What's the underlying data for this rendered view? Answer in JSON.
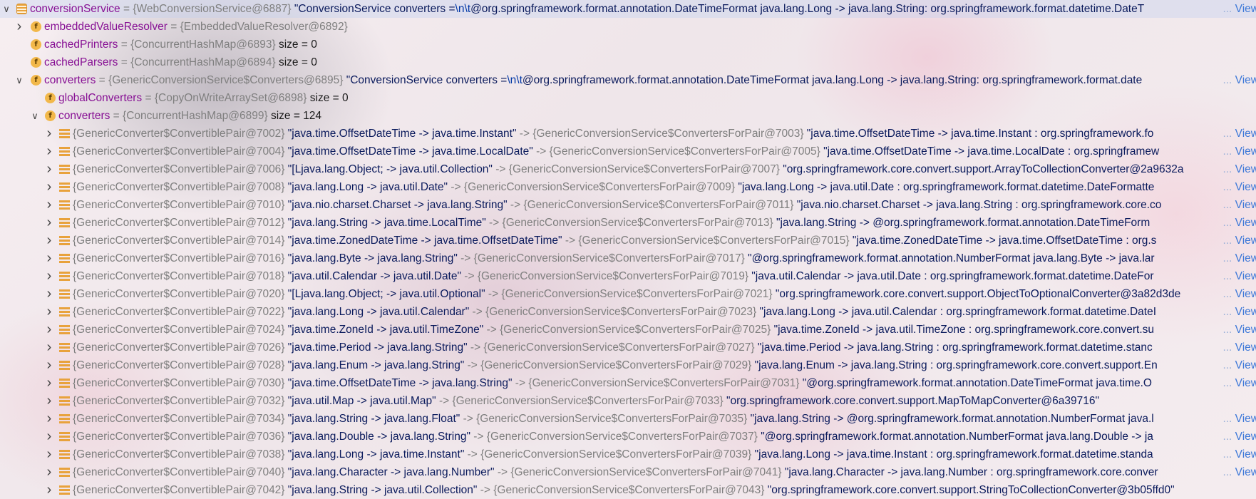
{
  "view_label": "View",
  "ellipsis": "...",
  "rows": [
    {
      "indent": 1,
      "chev": "down",
      "icon": "field-list",
      "selected": true,
      "name": "conversionService",
      "ref": "{WebConversionService@6887}",
      "value_parts": [
        {
          "t": "\"ConversionService converters =",
          "c": "str"
        },
        {
          "t": "\\n\\t",
          "c": "esc"
        },
        {
          "t": "@org.springframework.format.annotation.DateTimeFormat java.lang.Long -> java.lang.String: org.springframework.format.datetime.DateT",
          "c": "str"
        }
      ],
      "view": true
    },
    {
      "indent": 2,
      "chev": "right",
      "icon": "field",
      "name": "embeddedValueResolver",
      "ref": "{EmbeddedValueResolver@6892}",
      "value_parts": []
    },
    {
      "indent": 2,
      "chev": "",
      "icon": "field",
      "name": "cachedPrinters",
      "ref": "{ConcurrentHashMap@6893}",
      "value_parts": [
        {
          "t": " size = 0",
          "c": "sz"
        }
      ]
    },
    {
      "indent": 2,
      "chev": "",
      "icon": "field",
      "name": "cachedParsers",
      "ref": "{ConcurrentHashMap@6894}",
      "value_parts": [
        {
          "t": " size = 0",
          "c": "sz"
        }
      ]
    },
    {
      "indent": 2,
      "chev": "down",
      "icon": "field",
      "name": "converters",
      "ref": "{GenericConversionService$Converters@6895}",
      "value_parts": [
        {
          "t": "\"ConversionService converters =",
          "c": "str"
        },
        {
          "t": "\\n\\t",
          "c": "esc"
        },
        {
          "t": "@org.springframework.format.annotation.DateTimeFormat java.lang.Long -> java.lang.String: org.springframework.format.date",
          "c": "str"
        }
      ],
      "view": true
    },
    {
      "indent": 3,
      "chev": "",
      "icon": "field",
      "name": "globalConverters",
      "ref": "{CopyOnWriteArraySet@6898}",
      "value_parts": [
        {
          "t": " size = 0",
          "c": "sz"
        }
      ]
    },
    {
      "indent": 3,
      "chev": "down",
      "icon": "field",
      "name": "converters",
      "ref": "{ConcurrentHashMap@6899}",
      "value_parts": [
        {
          "t": " size = 124",
          "c": "sz"
        }
      ]
    },
    {
      "indent": 4,
      "chev": "right",
      "icon": "list",
      "name": "",
      "ref": "{GenericConverter$ConvertiblePair@7002}",
      "value_parts": [
        {
          "t": "\"java.time.OffsetDateTime -> java.time.Instant\"",
          "c": "str"
        },
        {
          "t": " -> {GenericConversionService$ConvertersForPair@7003}",
          "c": "ref"
        },
        {
          "t": " \"java.time.OffsetDateTime -> java.time.Instant : org.springframework.fo",
          "c": "str"
        }
      ],
      "view": true
    },
    {
      "indent": 4,
      "chev": "right",
      "icon": "list",
      "name": "",
      "ref": "{GenericConverter$ConvertiblePair@7004}",
      "value_parts": [
        {
          "t": "\"java.time.OffsetDateTime -> java.time.LocalDate\"",
          "c": "str"
        },
        {
          "t": " -> {GenericConversionService$ConvertersForPair@7005}",
          "c": "ref"
        },
        {
          "t": " \"java.time.OffsetDateTime -> java.time.LocalDate : org.springframew",
          "c": "str"
        }
      ],
      "view": true
    },
    {
      "indent": 4,
      "chev": "right",
      "icon": "list",
      "name": "",
      "ref": "{GenericConverter$ConvertiblePair@7006}",
      "value_parts": [
        {
          "t": "\"[Ljava.lang.Object; -> java.util.Collection\"",
          "c": "str"
        },
        {
          "t": " -> {GenericConversionService$ConvertersForPair@7007}",
          "c": "ref"
        },
        {
          "t": " \"org.springframework.core.convert.support.ArrayToCollectionConverter@2a9632a",
          "c": "str"
        }
      ],
      "view": true
    },
    {
      "indent": 4,
      "chev": "right",
      "icon": "list",
      "name": "",
      "ref": "{GenericConverter$ConvertiblePair@7008}",
      "value_parts": [
        {
          "t": "\"java.lang.Long -> java.util.Date\"",
          "c": "str"
        },
        {
          "t": " -> {GenericConversionService$ConvertersForPair@7009}",
          "c": "ref"
        },
        {
          "t": " \"java.lang.Long -> java.util.Date : org.springframework.format.datetime.DateFormatte",
          "c": "str"
        }
      ],
      "view": true
    },
    {
      "indent": 4,
      "chev": "right",
      "icon": "list",
      "name": "",
      "ref": "{GenericConverter$ConvertiblePair@7010}",
      "value_parts": [
        {
          "t": "\"java.nio.charset.Charset -> java.lang.String\"",
          "c": "str"
        },
        {
          "t": " -> {GenericConversionService$ConvertersForPair@7011}",
          "c": "ref"
        },
        {
          "t": " \"java.nio.charset.Charset -> java.lang.String : org.springframework.core.co",
          "c": "str"
        }
      ],
      "view": true
    },
    {
      "indent": 4,
      "chev": "right",
      "icon": "list",
      "name": "",
      "ref": "{GenericConverter$ConvertiblePair@7012}",
      "value_parts": [
        {
          "t": "\"java.lang.String -> java.time.LocalTime\"",
          "c": "str"
        },
        {
          "t": " -> {GenericConversionService$ConvertersForPair@7013}",
          "c": "ref"
        },
        {
          "t": " \"java.lang.String -> @org.springframework.format.annotation.DateTimeForm",
          "c": "str"
        }
      ],
      "view": true
    },
    {
      "indent": 4,
      "chev": "right",
      "icon": "list",
      "name": "",
      "ref": "{GenericConverter$ConvertiblePair@7014}",
      "value_parts": [
        {
          "t": "\"java.time.ZonedDateTime -> java.time.OffsetDateTime\"",
          "c": "str"
        },
        {
          "t": " -> {GenericConversionService$ConvertersForPair@7015}",
          "c": "ref"
        },
        {
          "t": " \"java.time.ZonedDateTime -> java.time.OffsetDateTime : org.s",
          "c": "str"
        }
      ],
      "view": true
    },
    {
      "indent": 4,
      "chev": "right",
      "icon": "list",
      "name": "",
      "ref": "{GenericConverter$ConvertiblePair@7016}",
      "value_parts": [
        {
          "t": "\"java.lang.Byte -> java.lang.String\"",
          "c": "str"
        },
        {
          "t": " -> {GenericConversionService$ConvertersForPair@7017}",
          "c": "ref"
        },
        {
          "t": " \"@org.springframework.format.annotation.NumberFormat java.lang.Byte -> java.lar",
          "c": "str"
        }
      ],
      "view": true
    },
    {
      "indent": 4,
      "chev": "right",
      "icon": "list",
      "name": "",
      "ref": "{GenericConverter$ConvertiblePair@7018}",
      "value_parts": [
        {
          "t": "\"java.util.Calendar -> java.util.Date\"",
          "c": "str"
        },
        {
          "t": " -> {GenericConversionService$ConvertersForPair@7019}",
          "c": "ref"
        },
        {
          "t": " \"java.util.Calendar -> java.util.Date : org.springframework.format.datetime.DateFor",
          "c": "str"
        }
      ],
      "view": true
    },
    {
      "indent": 4,
      "chev": "right",
      "icon": "list",
      "name": "",
      "ref": "{GenericConverter$ConvertiblePair@7020}",
      "value_parts": [
        {
          "t": "\"[Ljava.lang.Object; -> java.util.Optional\"",
          "c": "str"
        },
        {
          "t": " -> {GenericConversionService$ConvertersForPair@7021}",
          "c": "ref"
        },
        {
          "t": " \"org.springframework.core.convert.support.ObjectToOptionalConverter@3a82d3de",
          "c": "str"
        }
      ],
      "view": true
    },
    {
      "indent": 4,
      "chev": "right",
      "icon": "list",
      "name": "",
      "ref": "{GenericConverter$ConvertiblePair@7022}",
      "value_parts": [
        {
          "t": "\"java.lang.Long -> java.util.Calendar\"",
          "c": "str"
        },
        {
          "t": " -> {GenericConversionService$ConvertersForPair@7023}",
          "c": "ref"
        },
        {
          "t": " \"java.lang.Long -> java.util.Calendar : org.springframework.format.datetime.DateI",
          "c": "str"
        }
      ],
      "view": true
    },
    {
      "indent": 4,
      "chev": "right",
      "icon": "list",
      "name": "",
      "ref": "{GenericConverter$ConvertiblePair@7024}",
      "value_parts": [
        {
          "t": "\"java.time.ZoneId -> java.util.TimeZone\"",
          "c": "str"
        },
        {
          "t": " -> {GenericConversionService$ConvertersForPair@7025}",
          "c": "ref"
        },
        {
          "t": " \"java.time.ZoneId -> java.util.TimeZone : org.springframework.core.convert.su",
          "c": "str"
        }
      ],
      "view": true
    },
    {
      "indent": 4,
      "chev": "right",
      "icon": "list",
      "name": "",
      "ref": "{GenericConverter$ConvertiblePair@7026}",
      "value_parts": [
        {
          "t": "\"java.time.Period -> java.lang.String\"",
          "c": "str"
        },
        {
          "t": " -> {GenericConversionService$ConvertersForPair@7027}",
          "c": "ref"
        },
        {
          "t": " \"java.time.Period -> java.lang.String : org.springframework.format.datetime.stanc",
          "c": "str"
        }
      ],
      "view": true
    },
    {
      "indent": 4,
      "chev": "right",
      "icon": "list",
      "name": "",
      "ref": "{GenericConverter$ConvertiblePair@7028}",
      "value_parts": [
        {
          "t": "\"java.lang.Enum -> java.lang.String\"",
          "c": "str"
        },
        {
          "t": " -> {GenericConversionService$ConvertersForPair@7029}",
          "c": "ref"
        },
        {
          "t": " \"java.lang.Enum -> java.lang.String : org.springframework.core.convert.support.En",
          "c": "str"
        }
      ],
      "view": true
    },
    {
      "indent": 4,
      "chev": "right",
      "icon": "list",
      "name": "",
      "ref": "{GenericConverter$ConvertiblePair@7030}",
      "value_parts": [
        {
          "t": "\"java.time.OffsetDateTime -> java.lang.String\"",
          "c": "str"
        },
        {
          "t": " -> {GenericConversionService$ConvertersForPair@7031}",
          "c": "ref"
        },
        {
          "t": " \"@org.springframework.format.annotation.DateTimeFormat java.time.O",
          "c": "str"
        }
      ],
      "view": true
    },
    {
      "indent": 4,
      "chev": "right",
      "icon": "list",
      "name": "",
      "ref": "{GenericConverter$ConvertiblePair@7032}",
      "value_parts": [
        {
          "t": "\"java.util.Map -> java.util.Map\"",
          "c": "str"
        },
        {
          "t": " -> {GenericConversionService$ConvertersForPair@7033}",
          "c": "ref"
        },
        {
          "t": " \"org.springframework.core.convert.support.MapToMapConverter@6a39716\"",
          "c": "str"
        }
      ],
      "view": false
    },
    {
      "indent": 4,
      "chev": "right",
      "icon": "list",
      "name": "",
      "ref": "{GenericConverter$ConvertiblePair@7034}",
      "value_parts": [
        {
          "t": "\"java.lang.String -> java.lang.Float\"",
          "c": "str"
        },
        {
          "t": " -> {GenericConversionService$ConvertersForPair@7035}",
          "c": "ref"
        },
        {
          "t": " \"java.lang.String -> @org.springframework.format.annotation.NumberFormat java.l",
          "c": "str"
        }
      ],
      "view": true
    },
    {
      "indent": 4,
      "chev": "right",
      "icon": "list",
      "name": "",
      "ref": "{GenericConverter$ConvertiblePair@7036}",
      "value_parts": [
        {
          "t": "\"java.lang.Double -> java.lang.String\"",
          "c": "str"
        },
        {
          "t": " -> {GenericConversionService$ConvertersForPair@7037}",
          "c": "ref"
        },
        {
          "t": " \"@org.springframework.format.annotation.NumberFormat java.lang.Double -> ja",
          "c": "str"
        }
      ],
      "view": true
    },
    {
      "indent": 4,
      "chev": "right",
      "icon": "list",
      "name": "",
      "ref": "{GenericConverter$ConvertiblePair@7038}",
      "value_parts": [
        {
          "t": "\"java.lang.Long -> java.time.Instant\"",
          "c": "str"
        },
        {
          "t": " -> {GenericConversionService$ConvertersForPair@7039}",
          "c": "ref"
        },
        {
          "t": " \"java.lang.Long -> java.time.Instant : org.springframework.format.datetime.standa",
          "c": "str"
        }
      ],
      "view": true
    },
    {
      "indent": 4,
      "chev": "right",
      "icon": "list",
      "name": "",
      "ref": "{GenericConverter$ConvertiblePair@7040}",
      "value_parts": [
        {
          "t": "\"java.lang.Character -> java.lang.Number\"",
          "c": "str"
        },
        {
          "t": " -> {GenericConversionService$ConvertersForPair@7041}",
          "c": "ref"
        },
        {
          "t": " \"java.lang.Character -> java.lang.Number : org.springframework.core.conver",
          "c": "str"
        }
      ],
      "view": true
    },
    {
      "indent": 4,
      "chev": "right",
      "icon": "list",
      "name": "",
      "ref": "{GenericConverter$ConvertiblePair@7042}",
      "value_parts": [
        {
          "t": "\"java.lang.String -> java.util.Collection\"",
          "c": "str"
        },
        {
          "t": " -> {GenericConversionService$ConvertersForPair@7043}",
          "c": "ref"
        },
        {
          "t": " \"org.springframework.core.convert.support.StringToCollectionConverter@3b05ffd0\"",
          "c": "str"
        }
      ],
      "view": false
    }
  ]
}
